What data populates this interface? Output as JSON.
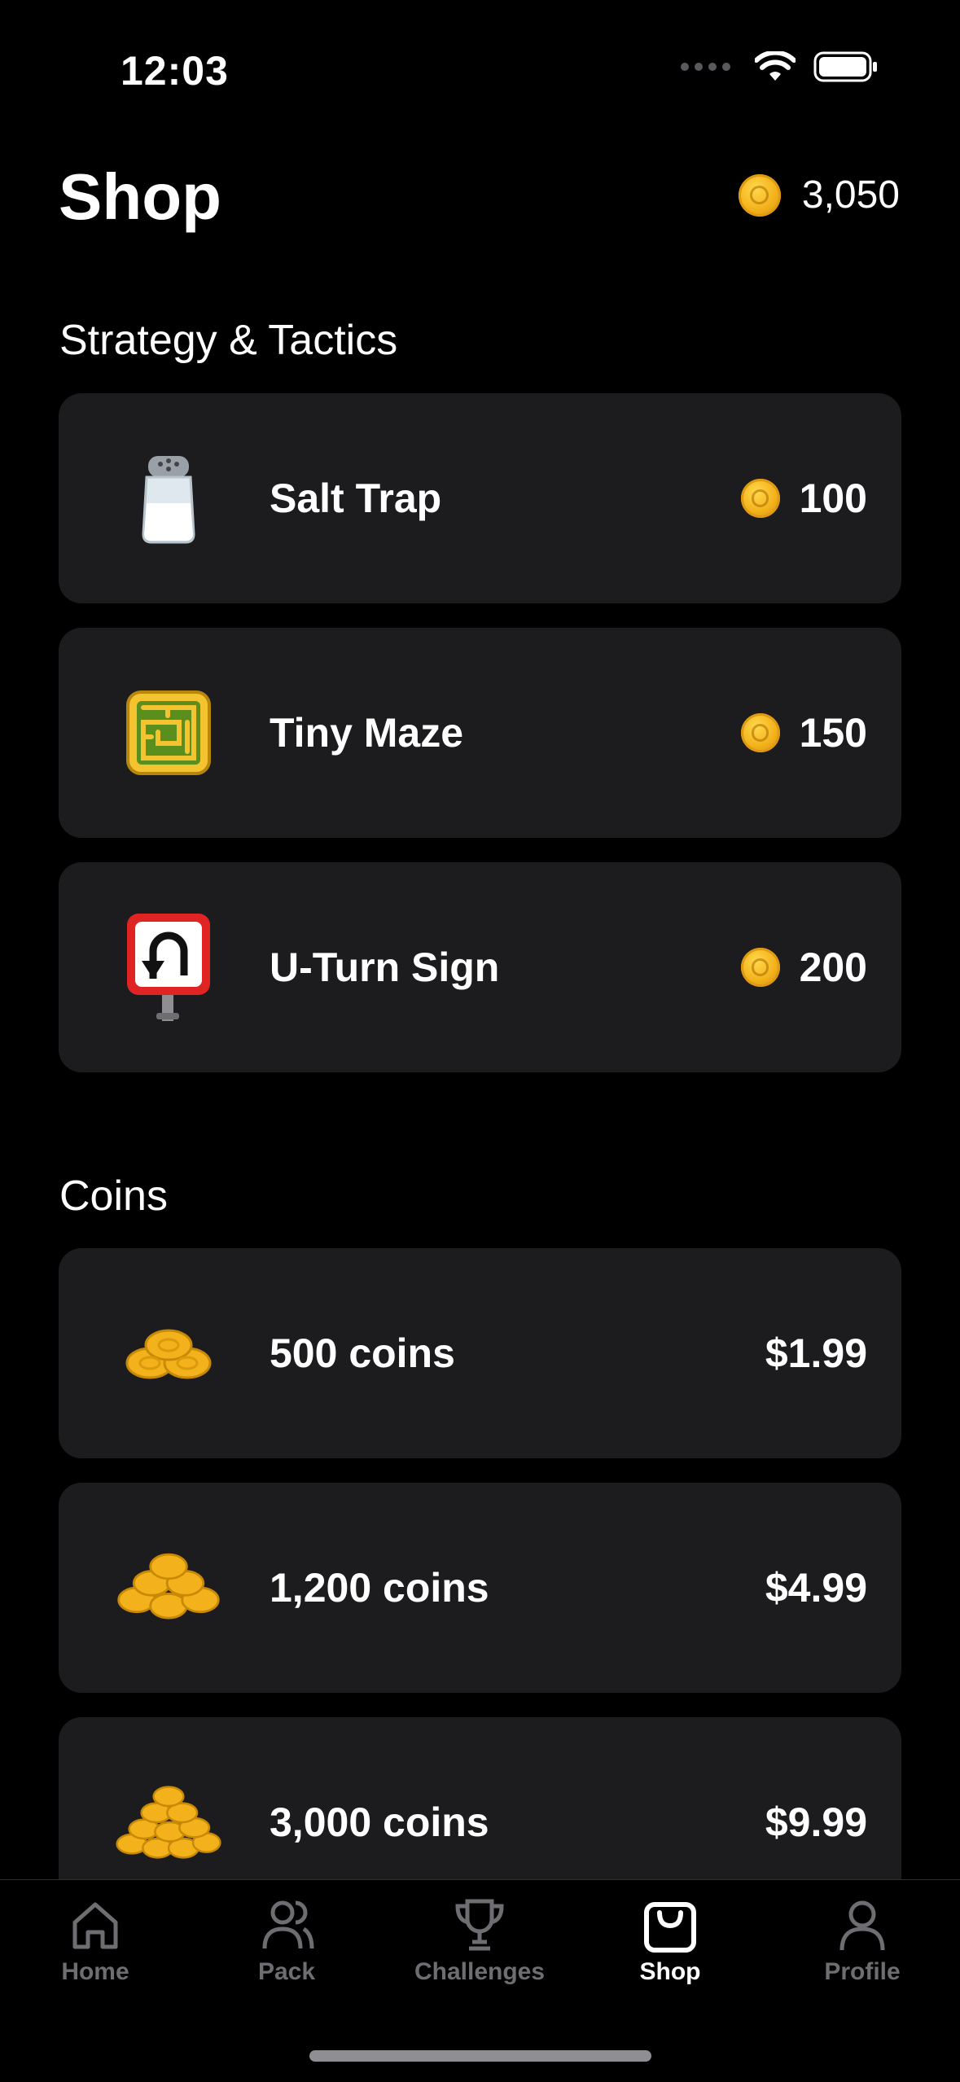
{
  "status_bar": {
    "time": "12:03"
  },
  "header": {
    "title": "Shop",
    "balance": "3,050"
  },
  "sections": [
    {
      "title": "Strategy & Tactics",
      "items": [
        {
          "name": "Salt Trap",
          "price": "100",
          "icon": "salt-shaker-icon"
        },
        {
          "name": "Tiny Maze",
          "price": "150",
          "icon": "maze-icon"
        },
        {
          "name": "U-Turn Sign",
          "price": "200",
          "icon": "u-turn-sign-icon"
        }
      ]
    },
    {
      "title": "Coins",
      "items": [
        {
          "name": "500 coins",
          "price": "$1.99",
          "icon": "coin-pile-small-icon"
        },
        {
          "name": "1,200 coins",
          "price": "$4.99",
          "icon": "coin-pile-medium-icon"
        },
        {
          "name": "3,000 coins",
          "price": "$9.99",
          "icon": "coin-pile-large-icon"
        }
      ]
    }
  ],
  "tabbar": {
    "tabs": [
      {
        "label": "Home",
        "icon": "home-icon"
      },
      {
        "label": "Pack",
        "icon": "pack-icon"
      },
      {
        "label": "Challenges",
        "icon": "trophy-icon"
      },
      {
        "label": "Shop",
        "icon": "shopping-bag-icon",
        "active": true
      },
      {
        "label": "Profile",
        "icon": "profile-icon"
      }
    ]
  },
  "colors": {
    "background": "#000000",
    "card": "#1c1c1e",
    "coin": "#f3b21c",
    "inactive_tab": "#6d6d72"
  }
}
